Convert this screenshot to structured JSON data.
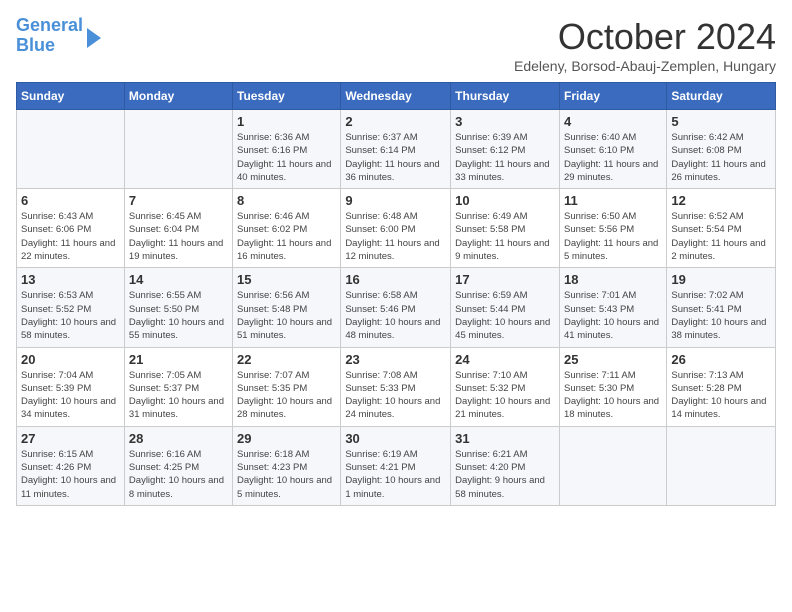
{
  "header": {
    "logo_line1": "General",
    "logo_line2": "Blue",
    "month": "October 2024",
    "location": "Edeleny, Borsod-Abauj-Zemplen, Hungary"
  },
  "weekdays": [
    "Sunday",
    "Monday",
    "Tuesday",
    "Wednesday",
    "Thursday",
    "Friday",
    "Saturday"
  ],
  "weeks": [
    [
      {
        "day": "",
        "info": ""
      },
      {
        "day": "",
        "info": ""
      },
      {
        "day": "1",
        "info": "Sunrise: 6:36 AM\nSunset: 6:16 PM\nDaylight: 11 hours and 40 minutes."
      },
      {
        "day": "2",
        "info": "Sunrise: 6:37 AM\nSunset: 6:14 PM\nDaylight: 11 hours and 36 minutes."
      },
      {
        "day": "3",
        "info": "Sunrise: 6:39 AM\nSunset: 6:12 PM\nDaylight: 11 hours and 33 minutes."
      },
      {
        "day": "4",
        "info": "Sunrise: 6:40 AM\nSunset: 6:10 PM\nDaylight: 11 hours and 29 minutes."
      },
      {
        "day": "5",
        "info": "Sunrise: 6:42 AM\nSunset: 6:08 PM\nDaylight: 11 hours and 26 minutes."
      }
    ],
    [
      {
        "day": "6",
        "info": "Sunrise: 6:43 AM\nSunset: 6:06 PM\nDaylight: 11 hours and 22 minutes."
      },
      {
        "day": "7",
        "info": "Sunrise: 6:45 AM\nSunset: 6:04 PM\nDaylight: 11 hours and 19 minutes."
      },
      {
        "day": "8",
        "info": "Sunrise: 6:46 AM\nSunset: 6:02 PM\nDaylight: 11 hours and 16 minutes."
      },
      {
        "day": "9",
        "info": "Sunrise: 6:48 AM\nSunset: 6:00 PM\nDaylight: 11 hours and 12 minutes."
      },
      {
        "day": "10",
        "info": "Sunrise: 6:49 AM\nSunset: 5:58 PM\nDaylight: 11 hours and 9 minutes."
      },
      {
        "day": "11",
        "info": "Sunrise: 6:50 AM\nSunset: 5:56 PM\nDaylight: 11 hours and 5 minutes."
      },
      {
        "day": "12",
        "info": "Sunrise: 6:52 AM\nSunset: 5:54 PM\nDaylight: 11 hours and 2 minutes."
      }
    ],
    [
      {
        "day": "13",
        "info": "Sunrise: 6:53 AM\nSunset: 5:52 PM\nDaylight: 10 hours and 58 minutes."
      },
      {
        "day": "14",
        "info": "Sunrise: 6:55 AM\nSunset: 5:50 PM\nDaylight: 10 hours and 55 minutes."
      },
      {
        "day": "15",
        "info": "Sunrise: 6:56 AM\nSunset: 5:48 PM\nDaylight: 10 hours and 51 minutes."
      },
      {
        "day": "16",
        "info": "Sunrise: 6:58 AM\nSunset: 5:46 PM\nDaylight: 10 hours and 48 minutes."
      },
      {
        "day": "17",
        "info": "Sunrise: 6:59 AM\nSunset: 5:44 PM\nDaylight: 10 hours and 45 minutes."
      },
      {
        "day": "18",
        "info": "Sunrise: 7:01 AM\nSunset: 5:43 PM\nDaylight: 10 hours and 41 minutes."
      },
      {
        "day": "19",
        "info": "Sunrise: 7:02 AM\nSunset: 5:41 PM\nDaylight: 10 hours and 38 minutes."
      }
    ],
    [
      {
        "day": "20",
        "info": "Sunrise: 7:04 AM\nSunset: 5:39 PM\nDaylight: 10 hours and 34 minutes."
      },
      {
        "day": "21",
        "info": "Sunrise: 7:05 AM\nSunset: 5:37 PM\nDaylight: 10 hours and 31 minutes."
      },
      {
        "day": "22",
        "info": "Sunrise: 7:07 AM\nSunset: 5:35 PM\nDaylight: 10 hours and 28 minutes."
      },
      {
        "day": "23",
        "info": "Sunrise: 7:08 AM\nSunset: 5:33 PM\nDaylight: 10 hours and 24 minutes."
      },
      {
        "day": "24",
        "info": "Sunrise: 7:10 AM\nSunset: 5:32 PM\nDaylight: 10 hours and 21 minutes."
      },
      {
        "day": "25",
        "info": "Sunrise: 7:11 AM\nSunset: 5:30 PM\nDaylight: 10 hours and 18 minutes."
      },
      {
        "day": "26",
        "info": "Sunrise: 7:13 AM\nSunset: 5:28 PM\nDaylight: 10 hours and 14 minutes."
      }
    ],
    [
      {
        "day": "27",
        "info": "Sunrise: 6:15 AM\nSunset: 4:26 PM\nDaylight: 10 hours and 11 minutes."
      },
      {
        "day": "28",
        "info": "Sunrise: 6:16 AM\nSunset: 4:25 PM\nDaylight: 10 hours and 8 minutes."
      },
      {
        "day": "29",
        "info": "Sunrise: 6:18 AM\nSunset: 4:23 PM\nDaylight: 10 hours and 5 minutes."
      },
      {
        "day": "30",
        "info": "Sunrise: 6:19 AM\nSunset: 4:21 PM\nDaylight: 10 hours and 1 minute."
      },
      {
        "day": "31",
        "info": "Sunrise: 6:21 AM\nSunset: 4:20 PM\nDaylight: 9 hours and 58 minutes."
      },
      {
        "day": "",
        "info": ""
      },
      {
        "day": "",
        "info": ""
      }
    ]
  ]
}
